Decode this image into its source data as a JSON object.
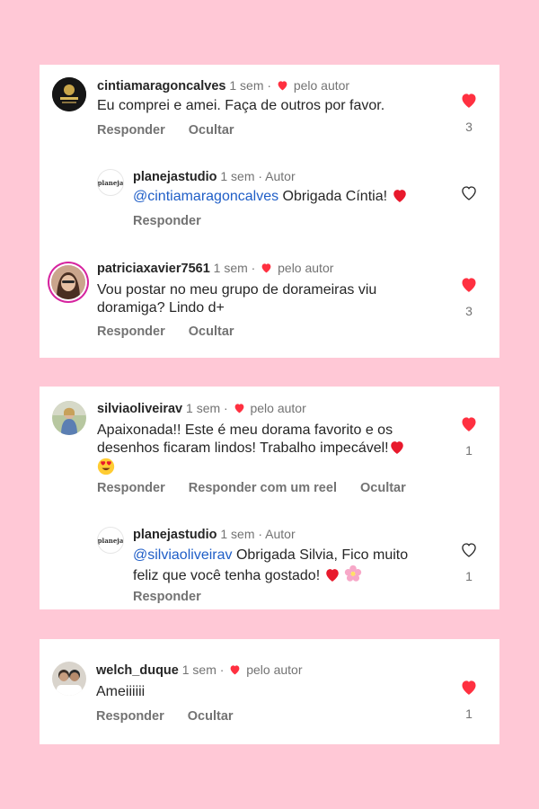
{
  "author_badge": "pelo autor",
  "author_tag": "Autor",
  "reply_label": "Responder",
  "hide_label": "Ocultar",
  "reel_reply_label": "Responder com um reel",
  "brand_logo_text": "planeja",
  "colors": {
    "background": "#ffc8d6",
    "heart": "#ff3040",
    "mention": "#1f5ec7"
  },
  "comments": [
    {
      "username": "cintiamaragoncalves",
      "time": "1 sem",
      "text": "Eu comprei e amei. Faça de outros por favor.",
      "likes": "3",
      "reply": {
        "username": "planejastudio",
        "time": "1 sem",
        "mention": "@cintiamaragoncalves",
        "text": " Obrigada Cíntia!"
      }
    },
    {
      "username": "patriciaxavier7561",
      "time": "1 sem",
      "text_line1": "Vou postar no meu grupo de dorameiras viu",
      "text_line2": "doramiga? Lindo d+",
      "likes": "3"
    },
    {
      "username": "silviaoliveirav",
      "time": "1 sem",
      "text_line1": "Apaixonada!! Este é meu dorama favorito e os",
      "text_line2": "desenhos ficaram lindos! Trabalho impecável!",
      "likes": "1",
      "reply": {
        "username": "planejastudio",
        "time": "1 sem",
        "mention": "@silviaoliveirav",
        "text_line1": " Obrigada Silvia, Fico muito",
        "text_line2": "feliz que você tenha gostado!",
        "likes": "1"
      }
    },
    {
      "username": "welch_duque",
      "time": "1 sem",
      "text": "Ameiiiiii",
      "likes": "1"
    }
  ]
}
